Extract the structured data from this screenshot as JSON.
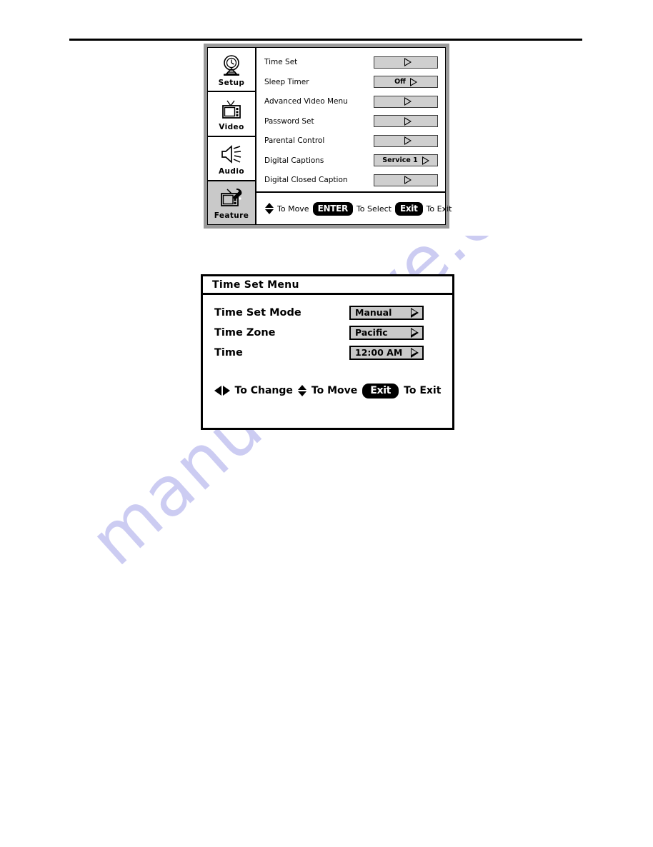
{
  "page": {
    "watermark_text": "manualshive.com",
    "watermark_color": "#ccccf2"
  },
  "feature_menu": {
    "sidebar": {
      "items": [
        {
          "label": "Setup",
          "icon": "clock-stand-icon",
          "active": false
        },
        {
          "label": "Video",
          "icon": "tv-antenna-icon",
          "active": false
        },
        {
          "label": "Audio",
          "icon": "speaker-icon",
          "active": false
        },
        {
          "label": "Feature",
          "icon": "tv-wrench-icon",
          "active": true
        }
      ]
    },
    "rows": [
      {
        "label": "Time Set",
        "value": "",
        "arrow": "triangle-right-icon"
      },
      {
        "label": "Sleep Timer",
        "value": "Off",
        "arrow": "triangle-right-icon"
      },
      {
        "label": "Advanced Video Menu",
        "value": "",
        "arrow": "triangle-right-icon"
      },
      {
        "label": "Password Set",
        "value": "",
        "arrow": "triangle-right-icon"
      },
      {
        "label": "Parental Control",
        "value": "",
        "arrow": "triangle-right-icon"
      },
      {
        "label": "Digital Captions",
        "value": "Service 1",
        "arrow": "triangle-right-icon"
      },
      {
        "label": "Digital Closed Caption",
        "value": "",
        "arrow": "triangle-right-icon"
      }
    ],
    "footer": {
      "move_hint": "To Move",
      "enter_key": "ENTER",
      "select_hint": "To Select",
      "exit_key": "Exit",
      "exit_hint": "To Exit"
    }
  },
  "time_set_menu": {
    "title": "Time Set Menu",
    "rows": [
      {
        "label": "Time Set Mode",
        "value": "Manual",
        "arrow": "triangle-right-icon"
      },
      {
        "label": "Time Zone",
        "value": "Pacific",
        "arrow": "triangle-right-icon"
      },
      {
        "label": "Time",
        "value": "12:00 AM",
        "arrow": "triangle-right-icon"
      }
    ],
    "footer": {
      "change_hint": "To Change",
      "move_hint": "To Move",
      "exit_key": "Exit",
      "exit_hint": "To Exit"
    }
  }
}
